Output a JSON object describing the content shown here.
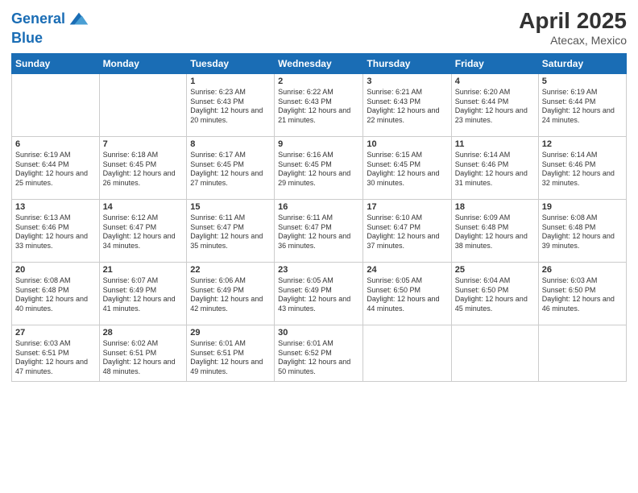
{
  "header": {
    "logo_line1": "General",
    "logo_line2": "Blue",
    "title": "April 2025",
    "subtitle": "Atecax, Mexico"
  },
  "weekdays": [
    "Sunday",
    "Monday",
    "Tuesday",
    "Wednesday",
    "Thursday",
    "Friday",
    "Saturday"
  ],
  "weeks": [
    [
      {
        "day": "",
        "text": ""
      },
      {
        "day": "",
        "text": ""
      },
      {
        "day": "1",
        "text": "Sunrise: 6:23 AM\nSunset: 6:43 PM\nDaylight: 12 hours and 20 minutes."
      },
      {
        "day": "2",
        "text": "Sunrise: 6:22 AM\nSunset: 6:43 PM\nDaylight: 12 hours and 21 minutes."
      },
      {
        "day": "3",
        "text": "Sunrise: 6:21 AM\nSunset: 6:43 PM\nDaylight: 12 hours and 22 minutes."
      },
      {
        "day": "4",
        "text": "Sunrise: 6:20 AM\nSunset: 6:44 PM\nDaylight: 12 hours and 23 minutes."
      },
      {
        "day": "5",
        "text": "Sunrise: 6:19 AM\nSunset: 6:44 PM\nDaylight: 12 hours and 24 minutes."
      }
    ],
    [
      {
        "day": "6",
        "text": "Sunrise: 6:19 AM\nSunset: 6:44 PM\nDaylight: 12 hours and 25 minutes."
      },
      {
        "day": "7",
        "text": "Sunrise: 6:18 AM\nSunset: 6:45 PM\nDaylight: 12 hours and 26 minutes."
      },
      {
        "day": "8",
        "text": "Sunrise: 6:17 AM\nSunset: 6:45 PM\nDaylight: 12 hours and 27 minutes."
      },
      {
        "day": "9",
        "text": "Sunrise: 6:16 AM\nSunset: 6:45 PM\nDaylight: 12 hours and 29 minutes."
      },
      {
        "day": "10",
        "text": "Sunrise: 6:15 AM\nSunset: 6:45 PM\nDaylight: 12 hours and 30 minutes."
      },
      {
        "day": "11",
        "text": "Sunrise: 6:14 AM\nSunset: 6:46 PM\nDaylight: 12 hours and 31 minutes."
      },
      {
        "day": "12",
        "text": "Sunrise: 6:14 AM\nSunset: 6:46 PM\nDaylight: 12 hours and 32 minutes."
      }
    ],
    [
      {
        "day": "13",
        "text": "Sunrise: 6:13 AM\nSunset: 6:46 PM\nDaylight: 12 hours and 33 minutes."
      },
      {
        "day": "14",
        "text": "Sunrise: 6:12 AM\nSunset: 6:47 PM\nDaylight: 12 hours and 34 minutes."
      },
      {
        "day": "15",
        "text": "Sunrise: 6:11 AM\nSunset: 6:47 PM\nDaylight: 12 hours and 35 minutes."
      },
      {
        "day": "16",
        "text": "Sunrise: 6:11 AM\nSunset: 6:47 PM\nDaylight: 12 hours and 36 minutes."
      },
      {
        "day": "17",
        "text": "Sunrise: 6:10 AM\nSunset: 6:47 PM\nDaylight: 12 hours and 37 minutes."
      },
      {
        "day": "18",
        "text": "Sunrise: 6:09 AM\nSunset: 6:48 PM\nDaylight: 12 hours and 38 minutes."
      },
      {
        "day": "19",
        "text": "Sunrise: 6:08 AM\nSunset: 6:48 PM\nDaylight: 12 hours and 39 minutes."
      }
    ],
    [
      {
        "day": "20",
        "text": "Sunrise: 6:08 AM\nSunset: 6:48 PM\nDaylight: 12 hours and 40 minutes."
      },
      {
        "day": "21",
        "text": "Sunrise: 6:07 AM\nSunset: 6:49 PM\nDaylight: 12 hours and 41 minutes."
      },
      {
        "day": "22",
        "text": "Sunrise: 6:06 AM\nSunset: 6:49 PM\nDaylight: 12 hours and 42 minutes."
      },
      {
        "day": "23",
        "text": "Sunrise: 6:05 AM\nSunset: 6:49 PM\nDaylight: 12 hours and 43 minutes."
      },
      {
        "day": "24",
        "text": "Sunrise: 6:05 AM\nSunset: 6:50 PM\nDaylight: 12 hours and 44 minutes."
      },
      {
        "day": "25",
        "text": "Sunrise: 6:04 AM\nSunset: 6:50 PM\nDaylight: 12 hours and 45 minutes."
      },
      {
        "day": "26",
        "text": "Sunrise: 6:03 AM\nSunset: 6:50 PM\nDaylight: 12 hours and 46 minutes."
      }
    ],
    [
      {
        "day": "27",
        "text": "Sunrise: 6:03 AM\nSunset: 6:51 PM\nDaylight: 12 hours and 47 minutes."
      },
      {
        "day": "28",
        "text": "Sunrise: 6:02 AM\nSunset: 6:51 PM\nDaylight: 12 hours and 48 minutes."
      },
      {
        "day": "29",
        "text": "Sunrise: 6:01 AM\nSunset: 6:51 PM\nDaylight: 12 hours and 49 minutes."
      },
      {
        "day": "30",
        "text": "Sunrise: 6:01 AM\nSunset: 6:52 PM\nDaylight: 12 hours and 50 minutes."
      },
      {
        "day": "",
        "text": ""
      },
      {
        "day": "",
        "text": ""
      },
      {
        "day": "",
        "text": ""
      }
    ]
  ]
}
